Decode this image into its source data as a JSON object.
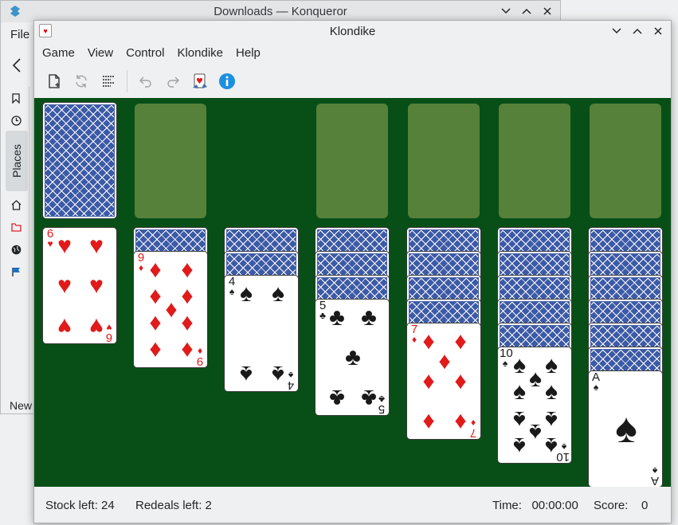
{
  "konqueror": {
    "title": "Downloads — Konqueror",
    "menu_file": "File",
    "places_label": "Places",
    "new_label": "New"
  },
  "klondike": {
    "title": "Klondike",
    "menu": [
      "Game",
      "View",
      "Control",
      "Klondike",
      "Help"
    ],
    "toolbar_icons": [
      "new-game-icon",
      "restart-icon",
      "choose-game-icon",
      "undo-icon",
      "redo-icon",
      "hint-icon",
      "info-icon"
    ],
    "piles": [
      {
        "down": 0,
        "up": {
          "rank": "6",
          "suit": "♥",
          "color": "red"
        }
      },
      {
        "down": 1,
        "up": {
          "rank": "9",
          "suit": "♦",
          "color": "red"
        }
      },
      {
        "down": 2,
        "up": {
          "rank": "4",
          "suit": "♠",
          "color": "black"
        }
      },
      {
        "down": 3,
        "up": {
          "rank": "5",
          "suit": "♣",
          "color": "black"
        }
      },
      {
        "down": 4,
        "up": {
          "rank": "7",
          "suit": "♦",
          "color": "red"
        }
      },
      {
        "down": 5,
        "up": {
          "rank": "10",
          "suit": "♠",
          "color": "black"
        }
      },
      {
        "down": 6,
        "up": {
          "rank": "A",
          "suit": "♠",
          "color": "black"
        }
      }
    ],
    "status": {
      "stock": "Stock left: 24",
      "redeals": "Redeals left: 2",
      "time": "Time:   00:00:00",
      "score": "Score:    0"
    },
    "colors": {
      "felt": "#084f17",
      "slot": "#55813a",
      "red": "#e11a1a",
      "black": "#1a1a1a",
      "card_back": "#3c5aa6"
    }
  }
}
